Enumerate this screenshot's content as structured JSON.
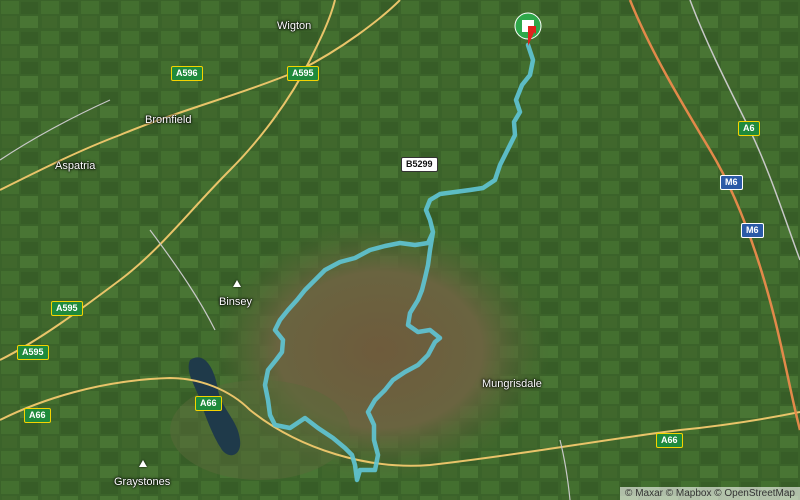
{
  "places": {
    "wigton": "Wigton",
    "bromfield": "Bromfield",
    "aspatria": "Aspatria",
    "binsey": "Binsey",
    "mungrisdale": "Mungrisdale",
    "graystones": "Graystones"
  },
  "roads": {
    "a596": "A596",
    "a595_top": "A595",
    "a595_mid": "A595",
    "a595_left": "A595",
    "b5299": "B5299",
    "a6": "A6",
    "m6_top": "M6",
    "m6_mid": "M6",
    "a66_left": "A66",
    "a66_mid": "A66",
    "a66_right": "A66"
  },
  "attribution": "© Maxar © Mapbox © OpenStreetMap",
  "colors": {
    "route": "#5fc3d3",
    "start_marker": "#2ea84a",
    "finish_flag": "#e0231e",
    "motorway": "#e2894a",
    "a_road": "#e9c46a",
    "minor_road": "#c8c8c8",
    "water": "#1f3a4a"
  },
  "icons": {
    "start": "start-finish-flag-icon",
    "peak": "mountain-peak-icon"
  }
}
